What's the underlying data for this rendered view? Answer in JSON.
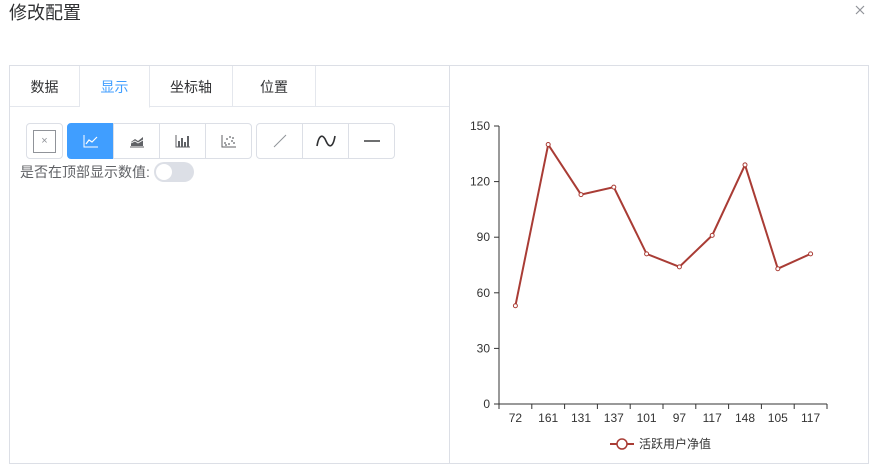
{
  "dialog": {
    "title": "修改配置"
  },
  "tabs": [
    {
      "label": "数据",
      "active": false
    },
    {
      "label": "显示",
      "active": true
    },
    {
      "label": "坐标轴",
      "active": false
    },
    {
      "label": "位置",
      "active": false
    }
  ],
  "toolbar": {
    "none_glyph": "×",
    "chart_types": [
      "line-chart-icon",
      "area-chart-icon",
      "bar-chart-icon",
      "scatter-chart-icon"
    ],
    "active_chart_type": "line-chart-icon",
    "line_styles": [
      "straight-line-icon",
      "smooth-line-icon",
      "horizontal-line-icon"
    ]
  },
  "options": {
    "show_top_values_label": "是否在顶部显示数值:",
    "show_top_values": false
  },
  "colors": {
    "accent": "#409eff",
    "series": "#a93c35"
  },
  "chart_data": {
    "type": "line",
    "categories": [
      "72",
      "161",
      "131",
      "137",
      "101",
      "97",
      "117",
      "148",
      "105",
      "117"
    ],
    "series": [
      {
        "name": "活跃用户净值",
        "values": [
          53,
          140,
          113,
          117,
          81,
          74,
          91,
          129,
          73,
          81
        ]
      }
    ],
    "ylim": [
      0,
      150
    ],
    "yticks": [
      "0",
      "30",
      "60",
      "90",
      "120",
      "150"
    ],
    "grid": false,
    "legend": "bottom-center"
  }
}
